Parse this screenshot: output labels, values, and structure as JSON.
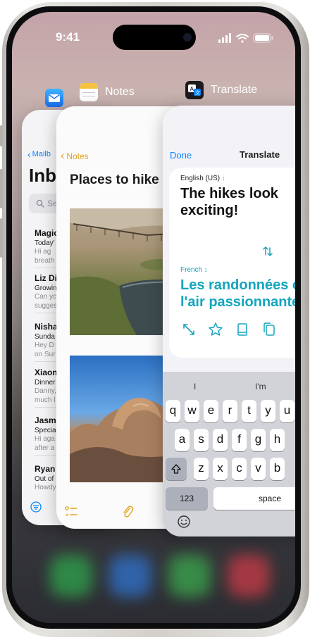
{
  "status_bar": {
    "time": "9:41"
  },
  "apps": {
    "mail": {
      "back_label": "Mailb",
      "title": "Inb",
      "search_placeholder": "Sea",
      "messages": [
        {
          "sender": "Magic",
          "subject": "Today'",
          "preview1": "Hi ag",
          "preview2": "breath"
        },
        {
          "sender": "Liz Di",
          "subject": "Growin",
          "preview1": "Can yc",
          "preview2": "sugges"
        },
        {
          "sender": "Nisha",
          "subject": "Sunda",
          "preview1": "Hey D",
          "preview2": "on Sur"
        },
        {
          "sender": "Xiaom",
          "subject": "Dinner",
          "preview1": "Danny,",
          "preview2": "much l"
        },
        {
          "sender": "Jasmi",
          "subject": "Specia",
          "preview1": "Hi aga",
          "preview2": "after a"
        },
        {
          "sender": "Ryan",
          "subject": "Out of",
          "preview1": "Howdy",
          "preview2": ""
        }
      ]
    },
    "notes": {
      "app_label": "Notes",
      "back_label": "Notes",
      "title": "Places to hike"
    },
    "translate": {
      "app_label": "Translate",
      "done_label": "Done",
      "header": "Translate",
      "source_language": "English (US)",
      "source_text": "The hikes look exciting!",
      "target_language": "French",
      "target_line1": "Les randonnées on",
      "target_line2": "l'air passionnantes"
    }
  },
  "keyboard": {
    "suggestions": [
      "I",
      "I'm"
    ],
    "row1": [
      "q",
      "w",
      "e",
      "r",
      "t",
      "y",
      "u"
    ],
    "row2": [
      "a",
      "s",
      "d",
      "f",
      "g",
      "h"
    ],
    "row3": [
      "z",
      "x",
      "c",
      "v",
      "b"
    ],
    "numbers_label": "123",
    "space_label": "space"
  },
  "colors": {
    "mail_accent": "#0a84ff",
    "notes_accent": "#e3a21a",
    "translate_accent": "#13a6bd",
    "dock": [
      "#2f9e4b",
      "#2f6fc4",
      "#3aa14c",
      "#c23a45"
    ]
  }
}
